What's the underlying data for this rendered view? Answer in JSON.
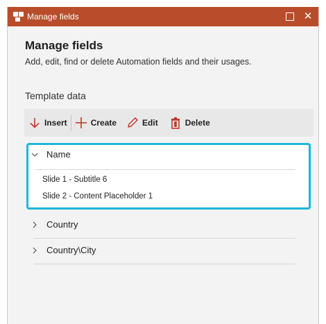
{
  "window": {
    "title": "Manage fields",
    "maximize_glyph": "☐",
    "close_glyph": "✕",
    "titlebar_color": "#b94d2b"
  },
  "header": {
    "title": "Manage fields",
    "description": "Add, edit, find or delete Automation fields and their usages."
  },
  "section": {
    "title": "Template data"
  },
  "toolbar": {
    "insert_label": "Insert",
    "create_label": "Create",
    "edit_label": "Edit",
    "delete_label": "Delete",
    "icons": [
      "arrow-down-icon",
      "plus-icon",
      "pencil-icon",
      "trash-icon"
    ],
    "icon_color": "#c0392b"
  },
  "fields": [
    {
      "name": "Name",
      "expanded": true,
      "selected": true,
      "usages": [
        "Slide 1 - Subtitle 6",
        "Slide 2 - Content Placeholder 1"
      ]
    },
    {
      "name": "Country",
      "expanded": false
    },
    {
      "name": "Country\\City",
      "expanded": false
    }
  ],
  "selection_color": "#1fb6d9"
}
